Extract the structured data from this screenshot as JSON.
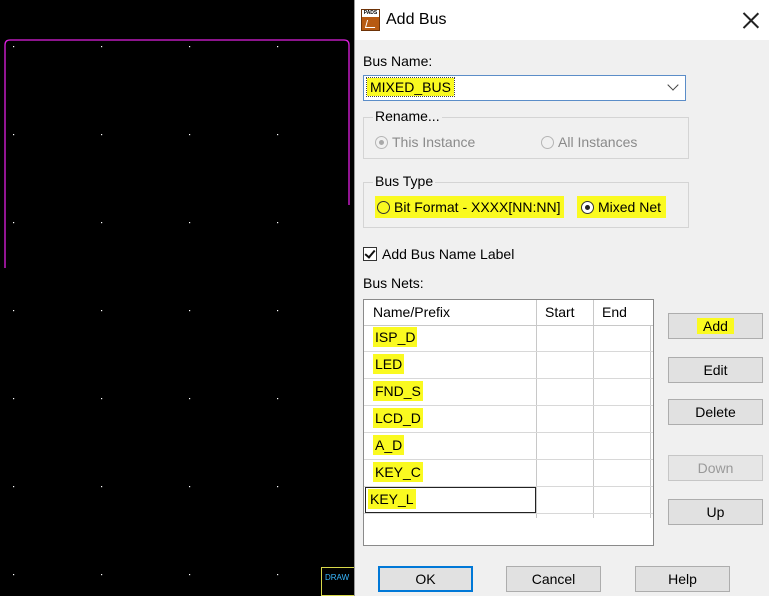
{
  "canvas": {
    "tag_label": "DRAW"
  },
  "dialog": {
    "title": "Add Bus",
    "icon_name": "pads-logic-icon",
    "icon_text": "PADS",
    "bus_name": {
      "label": "Bus Name:",
      "value": "MIXED_BUS"
    },
    "rename": {
      "legend": "Rename...",
      "options": [
        "This Instance",
        "All Instances"
      ],
      "selected": "This Instance"
    },
    "bus_type": {
      "legend": "Bus Type",
      "options": [
        "Bit Format - XXXX[NN:NN]",
        "Mixed Net"
      ],
      "selected": "Mixed Net"
    },
    "add_label": {
      "label": "Add Bus Name Label",
      "checked": true
    },
    "bus_nets": {
      "label": "Bus Nets:",
      "columns": [
        "Name/Prefix",
        "Start",
        "End"
      ],
      "rows": [
        "ISP_D",
        "LED",
        "FND_S",
        "LCD_D",
        "A_D",
        "KEY_C",
        "KEY_L"
      ]
    },
    "buttons": {
      "add": "Add",
      "edit": "Edit",
      "delete": "Delete",
      "down": "Down",
      "up": "Up",
      "ok": "OK",
      "cancel": "Cancel",
      "help": "Help"
    },
    "colors": {
      "highlight": "#fafa20",
      "board_outline": "#e020e0",
      "grid_dot": "#ffffff"
    }
  }
}
